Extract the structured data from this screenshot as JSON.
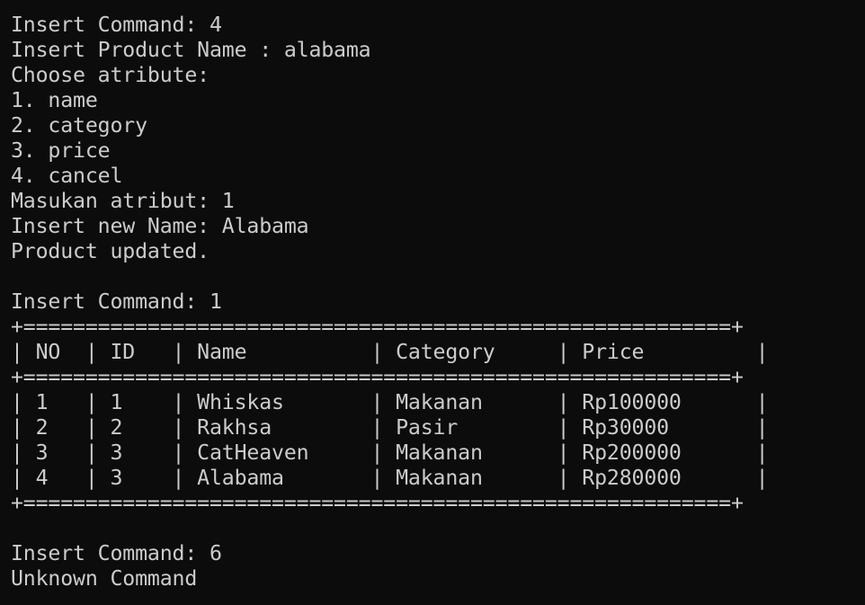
{
  "terminal": {
    "lines": [
      "Insert Command: 4",
      "Insert Product Name : alabama",
      "Choose atribute:",
      "1. name",
      "2. category",
      "3. price",
      "4. cancel",
      "Masukan atribut: 1",
      "Insert new Name: Alabama",
      "Product updated.",
      "",
      "Insert Command: 1",
      "+=========================================================+",
      "| NO  | ID   | Name          | Category     | Price         |",
      "+=========================================================+",
      "| 1   | 1    | Whiskas       | Makanan      | Rp100000      |",
      "| 2   | 2    | Rakhsa        | Pasir        | Rp30000       |",
      "| 3   | 3    | CatHeaven     | Makanan      | Rp200000      |",
      "| 4   | 3    | Alabama       | Makanan      | Rp280000      |",
      "+=========================================================+",
      "",
      "Insert Command: 6",
      "Unknown Command"
    ]
  }
}
